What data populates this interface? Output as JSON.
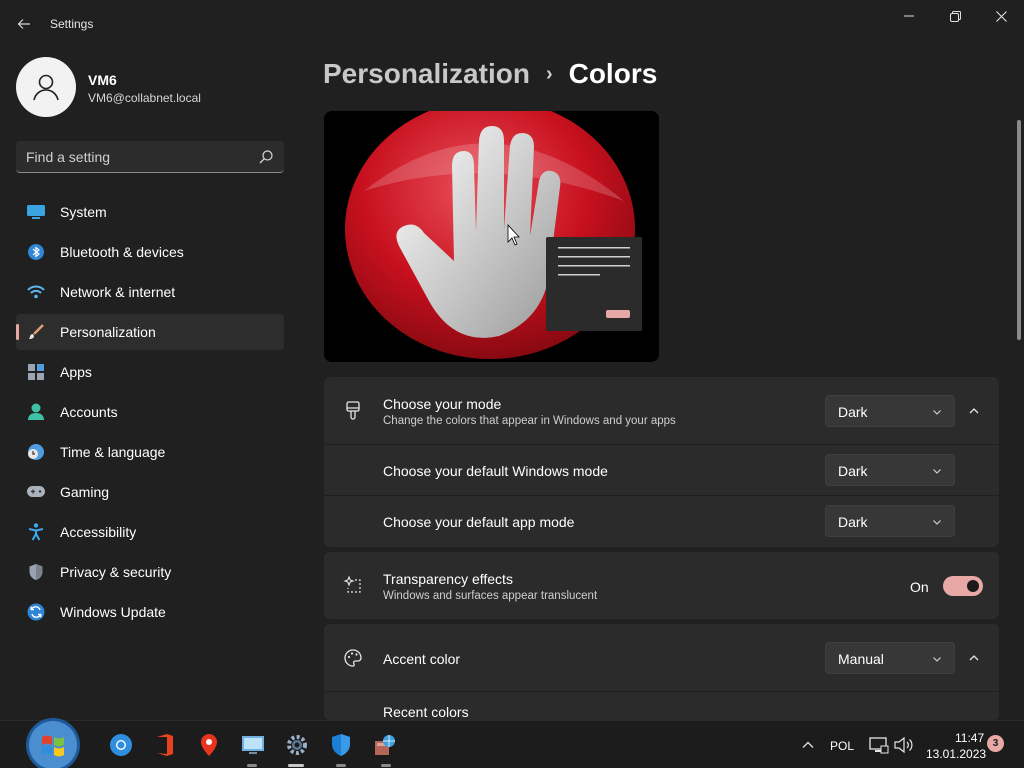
{
  "window": {
    "title": "Settings"
  },
  "user": {
    "name": "VM6",
    "email": "VM6@collabnet.local"
  },
  "search": {
    "placeholder": "Find a setting"
  },
  "sidebar": {
    "items": [
      {
        "label": "System",
        "icon": "system-icon"
      },
      {
        "label": "Bluetooth & devices",
        "icon": "bluetooth-icon"
      },
      {
        "label": "Network & internet",
        "icon": "wifi-icon"
      },
      {
        "label": "Personalization",
        "icon": "brush-icon",
        "active": true
      },
      {
        "label": "Apps",
        "icon": "apps-icon"
      },
      {
        "label": "Accounts",
        "icon": "accounts-icon"
      },
      {
        "label": "Time & language",
        "icon": "clock-globe-icon"
      },
      {
        "label": "Gaming",
        "icon": "gamepad-icon"
      },
      {
        "label": "Accessibility",
        "icon": "accessibility-icon"
      },
      {
        "label": "Privacy & security",
        "icon": "shield-icon"
      },
      {
        "label": "Windows Update",
        "icon": "update-icon"
      }
    ]
  },
  "header": {
    "parent": "Personalization",
    "separator": "›",
    "current": "Colors"
  },
  "mode": {
    "title": "Choose your mode",
    "subtitle": "Change the colors that appear in Windows and your apps",
    "value": "Dark",
    "windows_mode_label": "Choose your default Windows mode",
    "windows_mode_value": "Dark",
    "app_mode_label": "Choose your default app mode",
    "app_mode_value": "Dark"
  },
  "transparency": {
    "title": "Transparency effects",
    "subtitle": "Windows and surfaces appear translucent",
    "state_label": "On"
  },
  "accent": {
    "title": "Accent color",
    "value": "Manual",
    "recent_label": "Recent colors"
  },
  "taskbar": {
    "language": "POL",
    "time": "11:47",
    "date": "13.01.2023",
    "notification_count": "3"
  },
  "colors": {
    "accent": "#e8a8a6",
    "background": "#202020",
    "card": "#2b2b2b"
  }
}
